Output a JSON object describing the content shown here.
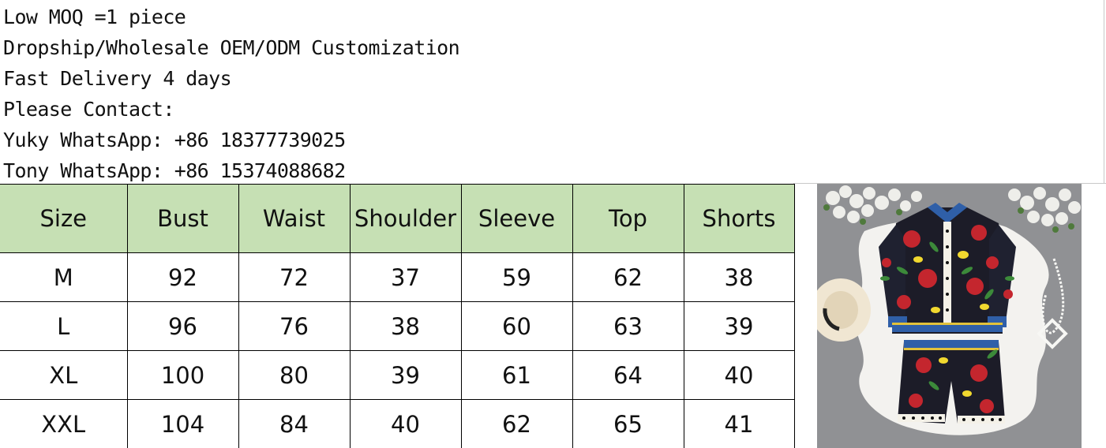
{
  "info": {
    "lines": [
      "Low MOQ =1 piece",
      "Dropship/Wholesale OEM/ODM Customization",
      "Fast Delivery 4 days",
      "Please Contact:",
      "Yuky WhatsApp: +86 18377739025",
      "Tony WhatsApp: +86 15374088682"
    ]
  },
  "size_table": {
    "headers": [
      "Size",
      "Bust",
      "Waist",
      "Shoulder",
      "Sleeve",
      "Top",
      "Shorts"
    ],
    "rows": [
      [
        "M",
        "92",
        "72",
        "37",
        "59",
        "62",
        "38"
      ],
      [
        "L",
        "96",
        "76",
        "38",
        "60",
        "63",
        "39"
      ],
      [
        "XL",
        "100",
        "80",
        "39",
        "61",
        "64",
        "40"
      ],
      [
        "XXL",
        "104",
        "84",
        "40",
        "62",
        "65",
        "41"
      ]
    ],
    "header_bg": "#c6e0b4"
  },
  "product_photo": {
    "icon": "printed-shirt-and-shorts-set-photo"
  }
}
